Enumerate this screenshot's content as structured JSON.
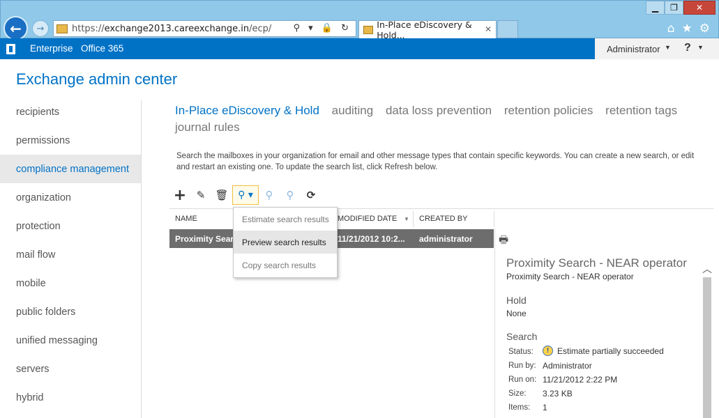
{
  "browser": {
    "url_prefix": "https://",
    "url_host": "exchange2013.careexchange.in",
    "url_path": "/ecp/",
    "tab_title": "In-Place eDiscovery & Hold...",
    "window_minimize": "▁",
    "window_restore": "❐",
    "window_close": "✕",
    "address_icons": "⚲ ▾ 🔒 ↻",
    "toolbar_icons": [
      "home-icon",
      "star-icon",
      "gear-icon"
    ]
  },
  "topbar": {
    "links": [
      "Enterprise",
      "Office 365"
    ],
    "user": "Administrator",
    "help": "?"
  },
  "app_title": "Exchange admin center",
  "left_nav": {
    "items": [
      "recipients",
      "permissions",
      "compliance management",
      "organization",
      "protection",
      "mail flow",
      "mobile",
      "public folders",
      "unified messaging",
      "servers",
      "hybrid"
    ],
    "active_index": 2
  },
  "tabs": [
    "In-Place eDiscovery & Hold",
    "auditing",
    "data loss prevention",
    "retention policies",
    "retention tags",
    "journal rules"
  ],
  "description": "Search the mailboxes in your organization for email and other message types that contain specific keywords. You can create a new search, or edit and restart an existing one. To update the search list, click Refresh below.",
  "toolbar": {
    "buttons": [
      "add-icon",
      "edit-icon",
      "delete-icon",
      "search-icon",
      "estimate-icon",
      "stop-search-icon",
      "refresh-icon"
    ]
  },
  "table": {
    "columns": [
      "NAME",
      "MODIFIED DATE",
      "CREATED BY"
    ],
    "rows": [
      {
        "name": "Proximity Search - NEAR operator",
        "modified": "11/21/2012 10:2...",
        "created_by": "administrator"
      }
    ]
  },
  "dropdown_menu": {
    "items": [
      "Estimate search results",
      "Preview search results",
      "Copy search results"
    ],
    "hover_index": 1
  },
  "details": {
    "title": "Proximity Search - NEAR operator",
    "subtitle": "Proximity Search - NEAR operator",
    "hold_heading": "Hold",
    "hold_value": "None",
    "search_heading": "Search",
    "status_label": "Status:",
    "status_value": "Estimate partially succeeded",
    "run_by_label": "Run by:",
    "run_by_value": "Administrator",
    "run_on_label": "Run on:",
    "run_on_value": "11/21/2012 2:22 PM",
    "size_label": "Size:",
    "size_value": "3.23 KB",
    "items_label": "Items:",
    "items_value": "1"
  },
  "colors": {
    "accent": "#0072c6",
    "selected_row": "#6d6d6d",
    "chrome": "#8fc8e8"
  }
}
